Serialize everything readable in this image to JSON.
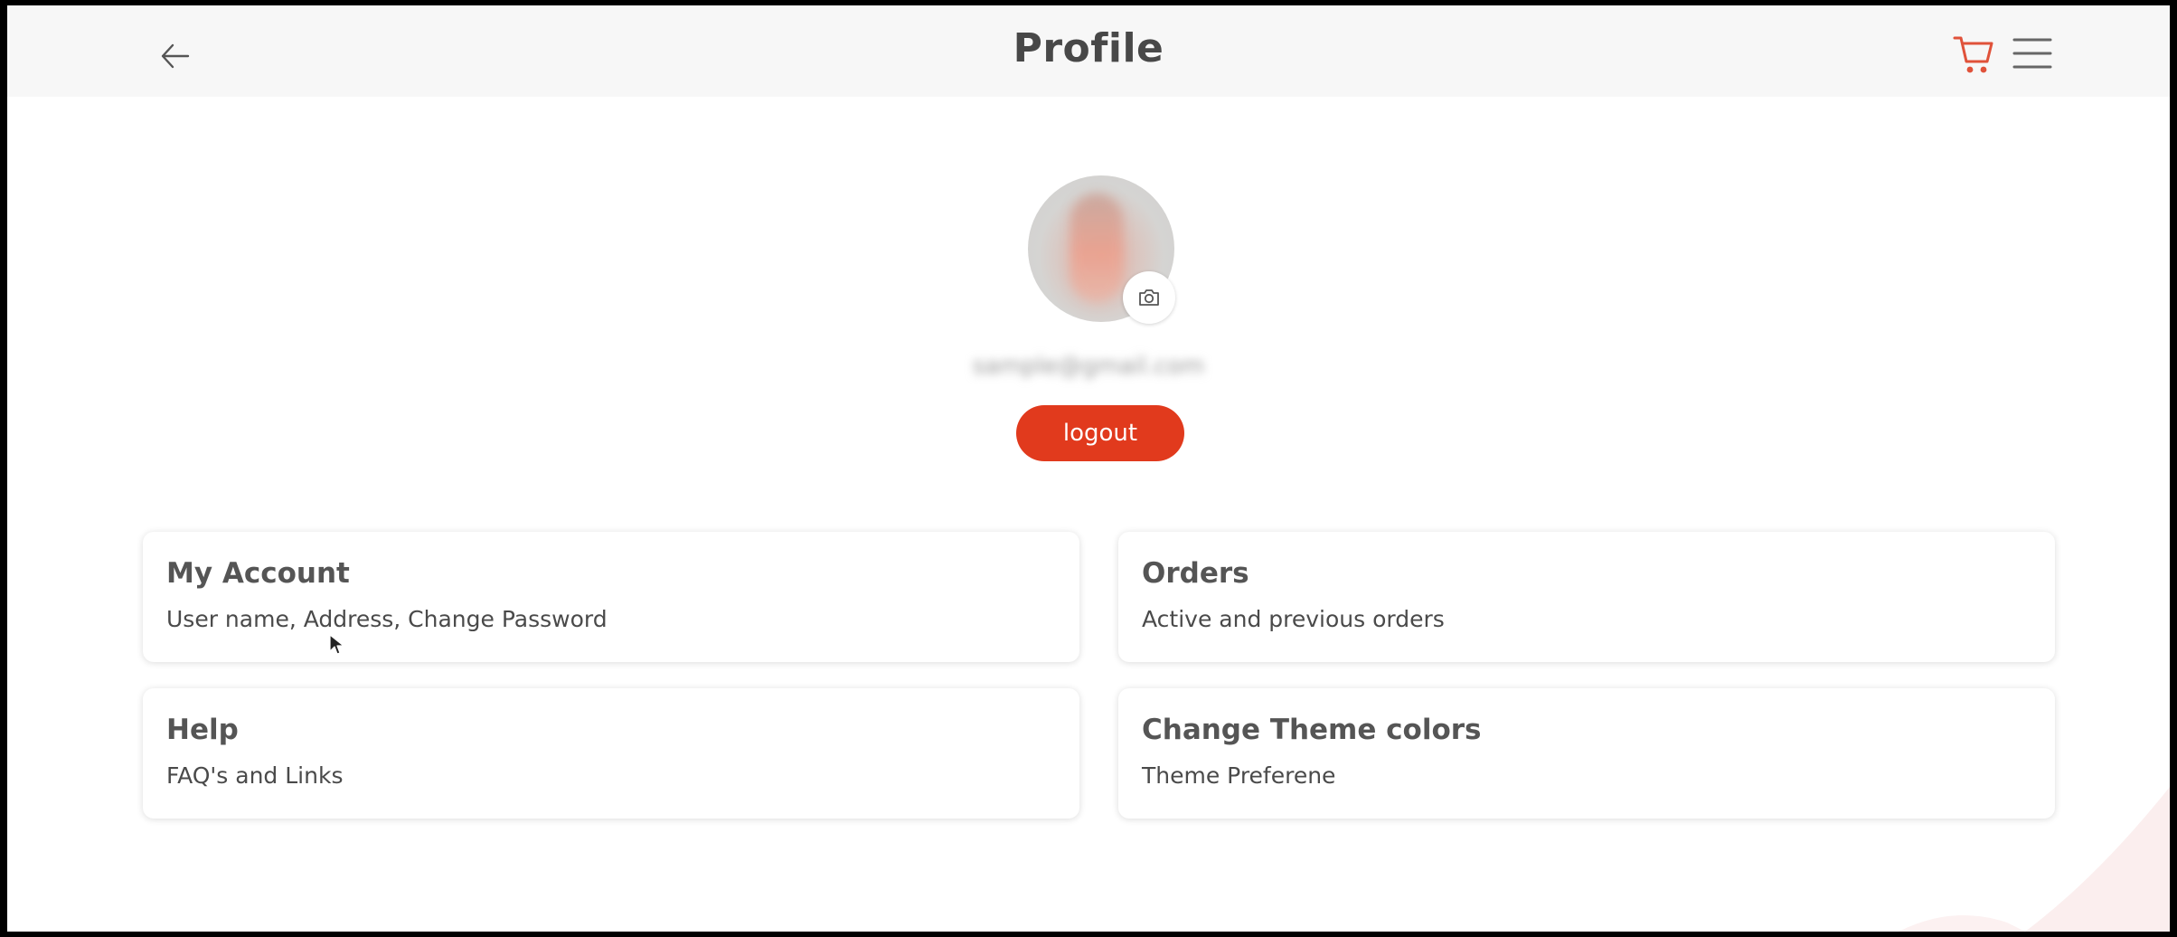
{
  "header": {
    "title": "Profile"
  },
  "profile": {
    "email": "sample@gmail.com",
    "logout_label": "logout"
  },
  "cards": [
    {
      "title": "My Account",
      "description": "User name, Address, Change Password"
    },
    {
      "title": "Orders",
      "description": "Active and previous orders"
    },
    {
      "title": "Help",
      "description": "FAQ's and Links"
    },
    {
      "title": "Change Theme colors",
      "description": "Theme Preferene"
    }
  ],
  "icons": {
    "back": "arrow-left-icon",
    "cart": "cart-icon",
    "menu": "hamburger-menu-icon",
    "camera": "camera-icon"
  },
  "colors": {
    "accent": "#e13a1d",
    "header_bg": "#f7f7f7",
    "title": "#484848"
  }
}
